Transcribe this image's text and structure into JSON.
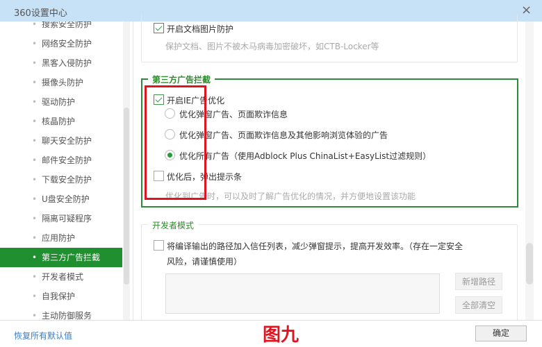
{
  "window": {
    "title": "360设置中心",
    "close_icon": "×"
  },
  "sidebar": {
    "items": [
      {
        "label": "搜索安全防护"
      },
      {
        "label": "网络安全防护"
      },
      {
        "label": "黑客入侵防护"
      },
      {
        "label": "摄像头防护"
      },
      {
        "label": "驱动防护"
      },
      {
        "label": "核晶防护"
      },
      {
        "label": "聊天安全防护"
      },
      {
        "label": "邮件安全防护"
      },
      {
        "label": "下载安全防护"
      },
      {
        "label": "U盘安全防护"
      },
      {
        "label": "隔离可疑程序"
      },
      {
        "label": "应用防护"
      },
      {
        "label": "第三方广告拦截",
        "active": true
      },
      {
        "label": "开发者模式"
      },
      {
        "label": "自我保护"
      },
      {
        "label": "主动防御服务"
      }
    ],
    "bullet": "•"
  },
  "doc_protect": {
    "checkbox_label": "开启文档图片防护",
    "checked": true,
    "desc": "保护文档、图片不被木马病毒加密破坏，如CTB-Locker等"
  },
  "ad_block": {
    "title": "第三方广告拦截",
    "ie_opt": {
      "label": "开启IE广告优化",
      "checked": true
    },
    "options": [
      {
        "label": "优化弹窗广告、页面欺诈信息",
        "selected": false
      },
      {
        "label": "优化弹窗广告、页面欺诈信息及其他影响浏览体验的广告",
        "selected": false
      },
      {
        "label": "优化所有广告（使用Adblock Plus ChinaList+EasyList过滤规则）",
        "selected": true
      }
    ],
    "popup": {
      "label": "优化后，弹出提示条",
      "checked": false
    },
    "desc": "优化到广告时，可以及时了解广告优化的情况，并方便地设置该功能"
  },
  "dev_mode": {
    "title": "开发者模式",
    "checkbox_line1": "将编译输出的路径加入信任列表，减少弹窗提示，提高开发效率。（存在一定安全",
    "checkbox_line2": "风险，请谨慎使用）",
    "checked": false,
    "add_path": "新增路径",
    "clear_all": "全部清空"
  },
  "footer": {
    "restore": "恢复所有默认值",
    "figure_label": "图九",
    "ok": "确定"
  },
  "colors": {
    "accent": "#1f8f2f",
    "annotation": "#e0141e",
    "titlebar": "#c7e1f7"
  }
}
